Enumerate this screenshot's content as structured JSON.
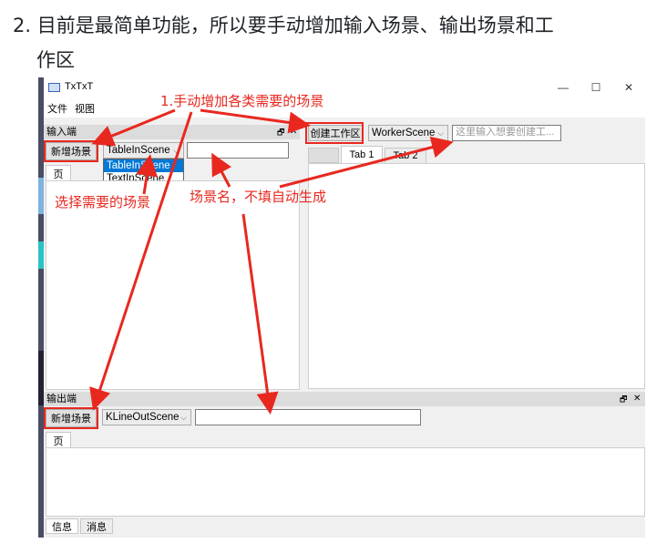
{
  "doc": {
    "line1": "2. 目前是最简单功能，所以要手动增加输入场景、输出场景和工",
    "line2": "作区"
  },
  "window": {
    "title": "TxTxT",
    "menu": [
      "文件",
      "视图"
    ],
    "controls": {
      "minimize": "—",
      "maximize": "☐",
      "close": "✕"
    }
  },
  "input_pane": {
    "title": "输入端",
    "float_glyph": "🗗",
    "close_glyph": "✕",
    "add_button": "新增场景",
    "scene_combo": "TableInScene",
    "dropdown_options": [
      "TableInScene",
      "TextInScene"
    ],
    "name_value": "",
    "tab": "页"
  },
  "workarea": {
    "create_button": "创建工作区",
    "scene_combo": "WorkerScene",
    "name_placeholder": "这里输入想要创建工...",
    "tabs": [
      "Tab 1",
      "Tab 2"
    ]
  },
  "output_pane": {
    "title": "输出端",
    "float_glyph": "🗗",
    "close_glyph": "✕",
    "add_button": "新增场景",
    "scene_combo": "KLineOutScene",
    "name_value": "",
    "tab": "页"
  },
  "status_tabs": [
    "信息",
    "消息"
  ],
  "annotations": {
    "top": "1.手动增加各类需要的场景",
    "select": "选择需要的场景",
    "name": "场景名，不填自动生成"
  },
  "colors": {
    "annotation": "#e8281f",
    "selection": "#0078d7"
  }
}
